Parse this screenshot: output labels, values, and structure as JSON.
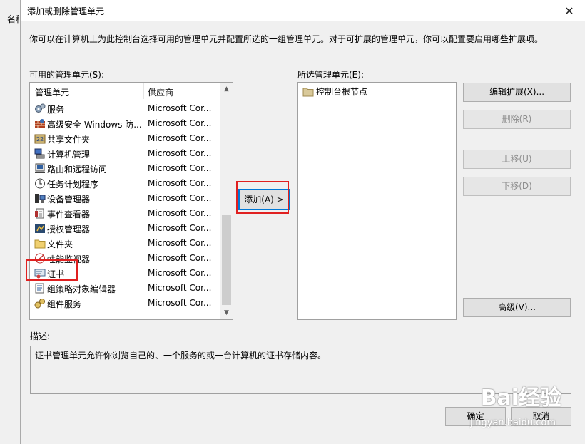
{
  "background_window": {
    "text": "名称"
  },
  "dialog": {
    "title": "添加或删除管理单元",
    "intro": "你可以在计算机上为此控制台选择可用的管理单元并配置所选的一组管理单元。对于可扩展的管理单元，你可以配置要启用哪些扩展项。"
  },
  "available": {
    "label": "可用的管理单元(S):",
    "columns": [
      "管理单元",
      "供应商"
    ],
    "items": [
      {
        "name": "服务",
        "vendor": "Microsoft Cor...",
        "icon": "gears-icon"
      },
      {
        "name": "高级安全 Windows 防...",
        "vendor": "Microsoft Cor...",
        "icon": "firewall-icon"
      },
      {
        "name": "共享文件夹",
        "vendor": "Microsoft Cor...",
        "icon": "shared-folder-icon"
      },
      {
        "name": "计算机管理",
        "vendor": "Microsoft Cor...",
        "icon": "computer-management-icon"
      },
      {
        "name": "路由和远程访问",
        "vendor": "Microsoft Cor...",
        "icon": "routing-icon"
      },
      {
        "name": "任务计划程序",
        "vendor": "Microsoft Cor...",
        "icon": "clock-icon"
      },
      {
        "name": "设备管理器",
        "vendor": "Microsoft Cor...",
        "icon": "device-manager-icon"
      },
      {
        "name": "事件查看器",
        "vendor": "Microsoft Cor...",
        "icon": "event-viewer-icon"
      },
      {
        "name": "授权管理器",
        "vendor": "Microsoft Cor...",
        "icon": "authorization-icon"
      },
      {
        "name": "文件夹",
        "vendor": "Microsoft Cor...",
        "icon": "folder-icon"
      },
      {
        "name": "性能监视器",
        "vendor": "Microsoft Cor...",
        "icon": "performance-icon"
      },
      {
        "name": "证书",
        "vendor": "Microsoft Cor...",
        "icon": "certificate-icon"
      },
      {
        "name": "组策略对象编辑器",
        "vendor": "Microsoft Cor...",
        "icon": "group-policy-icon"
      },
      {
        "name": "组件服务",
        "vendor": "Microsoft Cor...",
        "icon": "component-services-icon"
      }
    ]
  },
  "add_button": "添加(A) >",
  "selected": {
    "label": "所选管理单元(E):",
    "items": [
      {
        "name": "控制台根节点",
        "icon": "folder-icon"
      }
    ]
  },
  "side_buttons": {
    "edit_ext": "编辑扩展(X)...",
    "remove": "删除(R)",
    "move_up": "上移(U)",
    "move_down": "下移(D)",
    "advanced": "高级(V)..."
  },
  "description": {
    "label": "描述:",
    "text": "证书管理单元允许你浏览自己的、一个服务的或一台计算机的证书存储内容。"
  },
  "footer": {
    "ok": "确定",
    "cancel": "取消"
  },
  "watermark": {
    "brand": "Bai经验",
    "url": "jingyan.baidu.com"
  },
  "colors": {
    "highlight_red": "#e02020",
    "default_button_border": "#0078d7"
  }
}
